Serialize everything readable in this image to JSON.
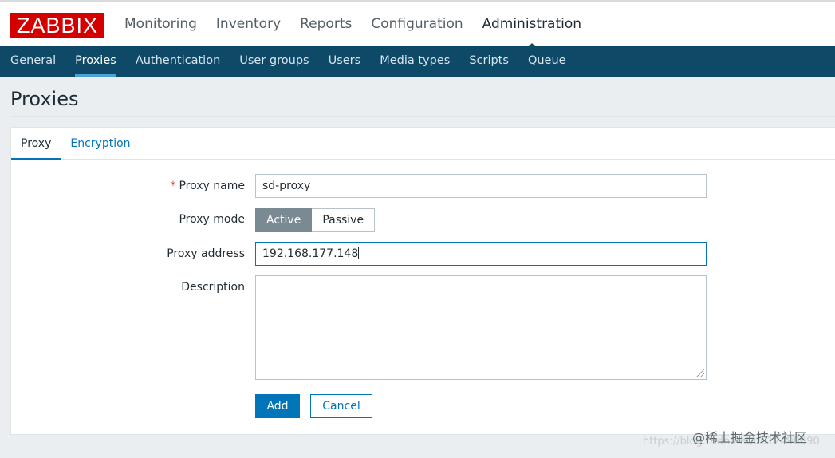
{
  "app": {
    "logo": "ZABBIX"
  },
  "main_nav": [
    {
      "label": "Monitoring"
    },
    {
      "label": "Inventory"
    },
    {
      "label": "Reports"
    },
    {
      "label": "Configuration"
    },
    {
      "label": "Administration",
      "active": true
    }
  ],
  "sub_nav": [
    {
      "label": "General"
    },
    {
      "label": "Proxies",
      "active": true
    },
    {
      "label": "Authentication"
    },
    {
      "label": "User groups"
    },
    {
      "label": "Users"
    },
    {
      "label": "Media types"
    },
    {
      "label": "Scripts"
    },
    {
      "label": "Queue"
    }
  ],
  "page": {
    "title": "Proxies"
  },
  "tabs": [
    {
      "label": "Proxy",
      "active": true
    },
    {
      "label": "Encryption"
    }
  ],
  "form": {
    "proxy_name": {
      "label": "Proxy name",
      "required_mark": "*",
      "value": "sd-proxy"
    },
    "proxy_mode": {
      "label": "Proxy mode",
      "options": [
        "Active",
        "Passive"
      ],
      "selected": "Active"
    },
    "proxy_address": {
      "label": "Proxy address",
      "value": "192.168.177.148"
    },
    "description": {
      "label": "Description",
      "value": ""
    },
    "buttons": {
      "add": "Add",
      "cancel": "Cancel"
    }
  },
  "watermark": {
    "text": "@稀土掘金技术社区",
    "url": "https://blog.csdn.net/u012498090"
  },
  "colors": {
    "logo_bg": "#d40000",
    "subnav_bg": "#0e4a68",
    "accent": "#0275b8",
    "segment_active": "#7a8a93"
  }
}
